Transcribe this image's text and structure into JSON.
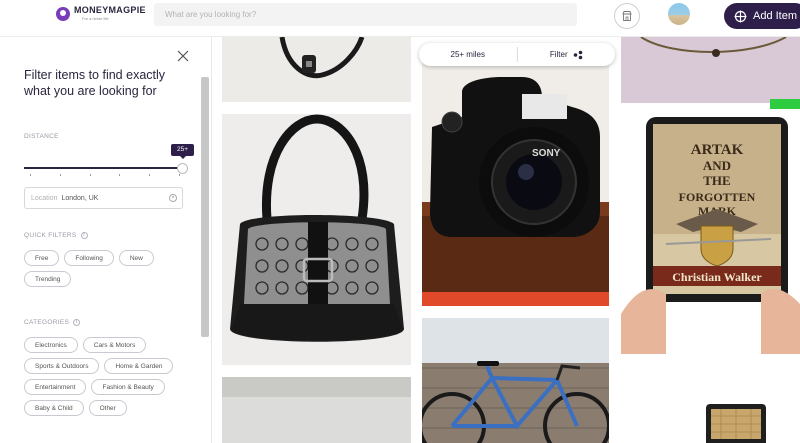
{
  "header": {
    "brand_name": "MONEYMAGPIE",
    "brand_tagline": "For a richer life",
    "search_placeholder": "What are you looking for?",
    "add_item_label": "Add Item"
  },
  "filters": {
    "title": "Filter items to find exactly what you are looking for",
    "distance_label": "DISTANCE",
    "distance_value": "25+",
    "location_label": "Location",
    "location_value": "London, UK",
    "quick_filters_label": "QUICK FILTERS",
    "quick_filters": [
      "Free",
      "Following",
      "New",
      "Trending"
    ],
    "categories_label": "CATEGORIES",
    "categories": [
      "Electronics",
      "Cars & Motors",
      "Sports & Outdoors",
      "Home & Garden",
      "Entertainment",
      "Fashion & Beauty",
      "Baby & Child",
      "Other"
    ]
  },
  "feed": {
    "distance_pill": "25+ miles",
    "filter_pill": "Filter",
    "camera_brand": "SONY",
    "book_title_line1": "ARTAK",
    "book_title_line2": "AND",
    "book_title_line3": "THE",
    "book_title_line4": "FORGOTTEN",
    "book_title_line5": "MARK",
    "book_author": "Christian Walker"
  },
  "colors": {
    "brand": "#2d1f4a",
    "accent_purple": "#7a3dba",
    "new_badge": "#2ecc40"
  }
}
